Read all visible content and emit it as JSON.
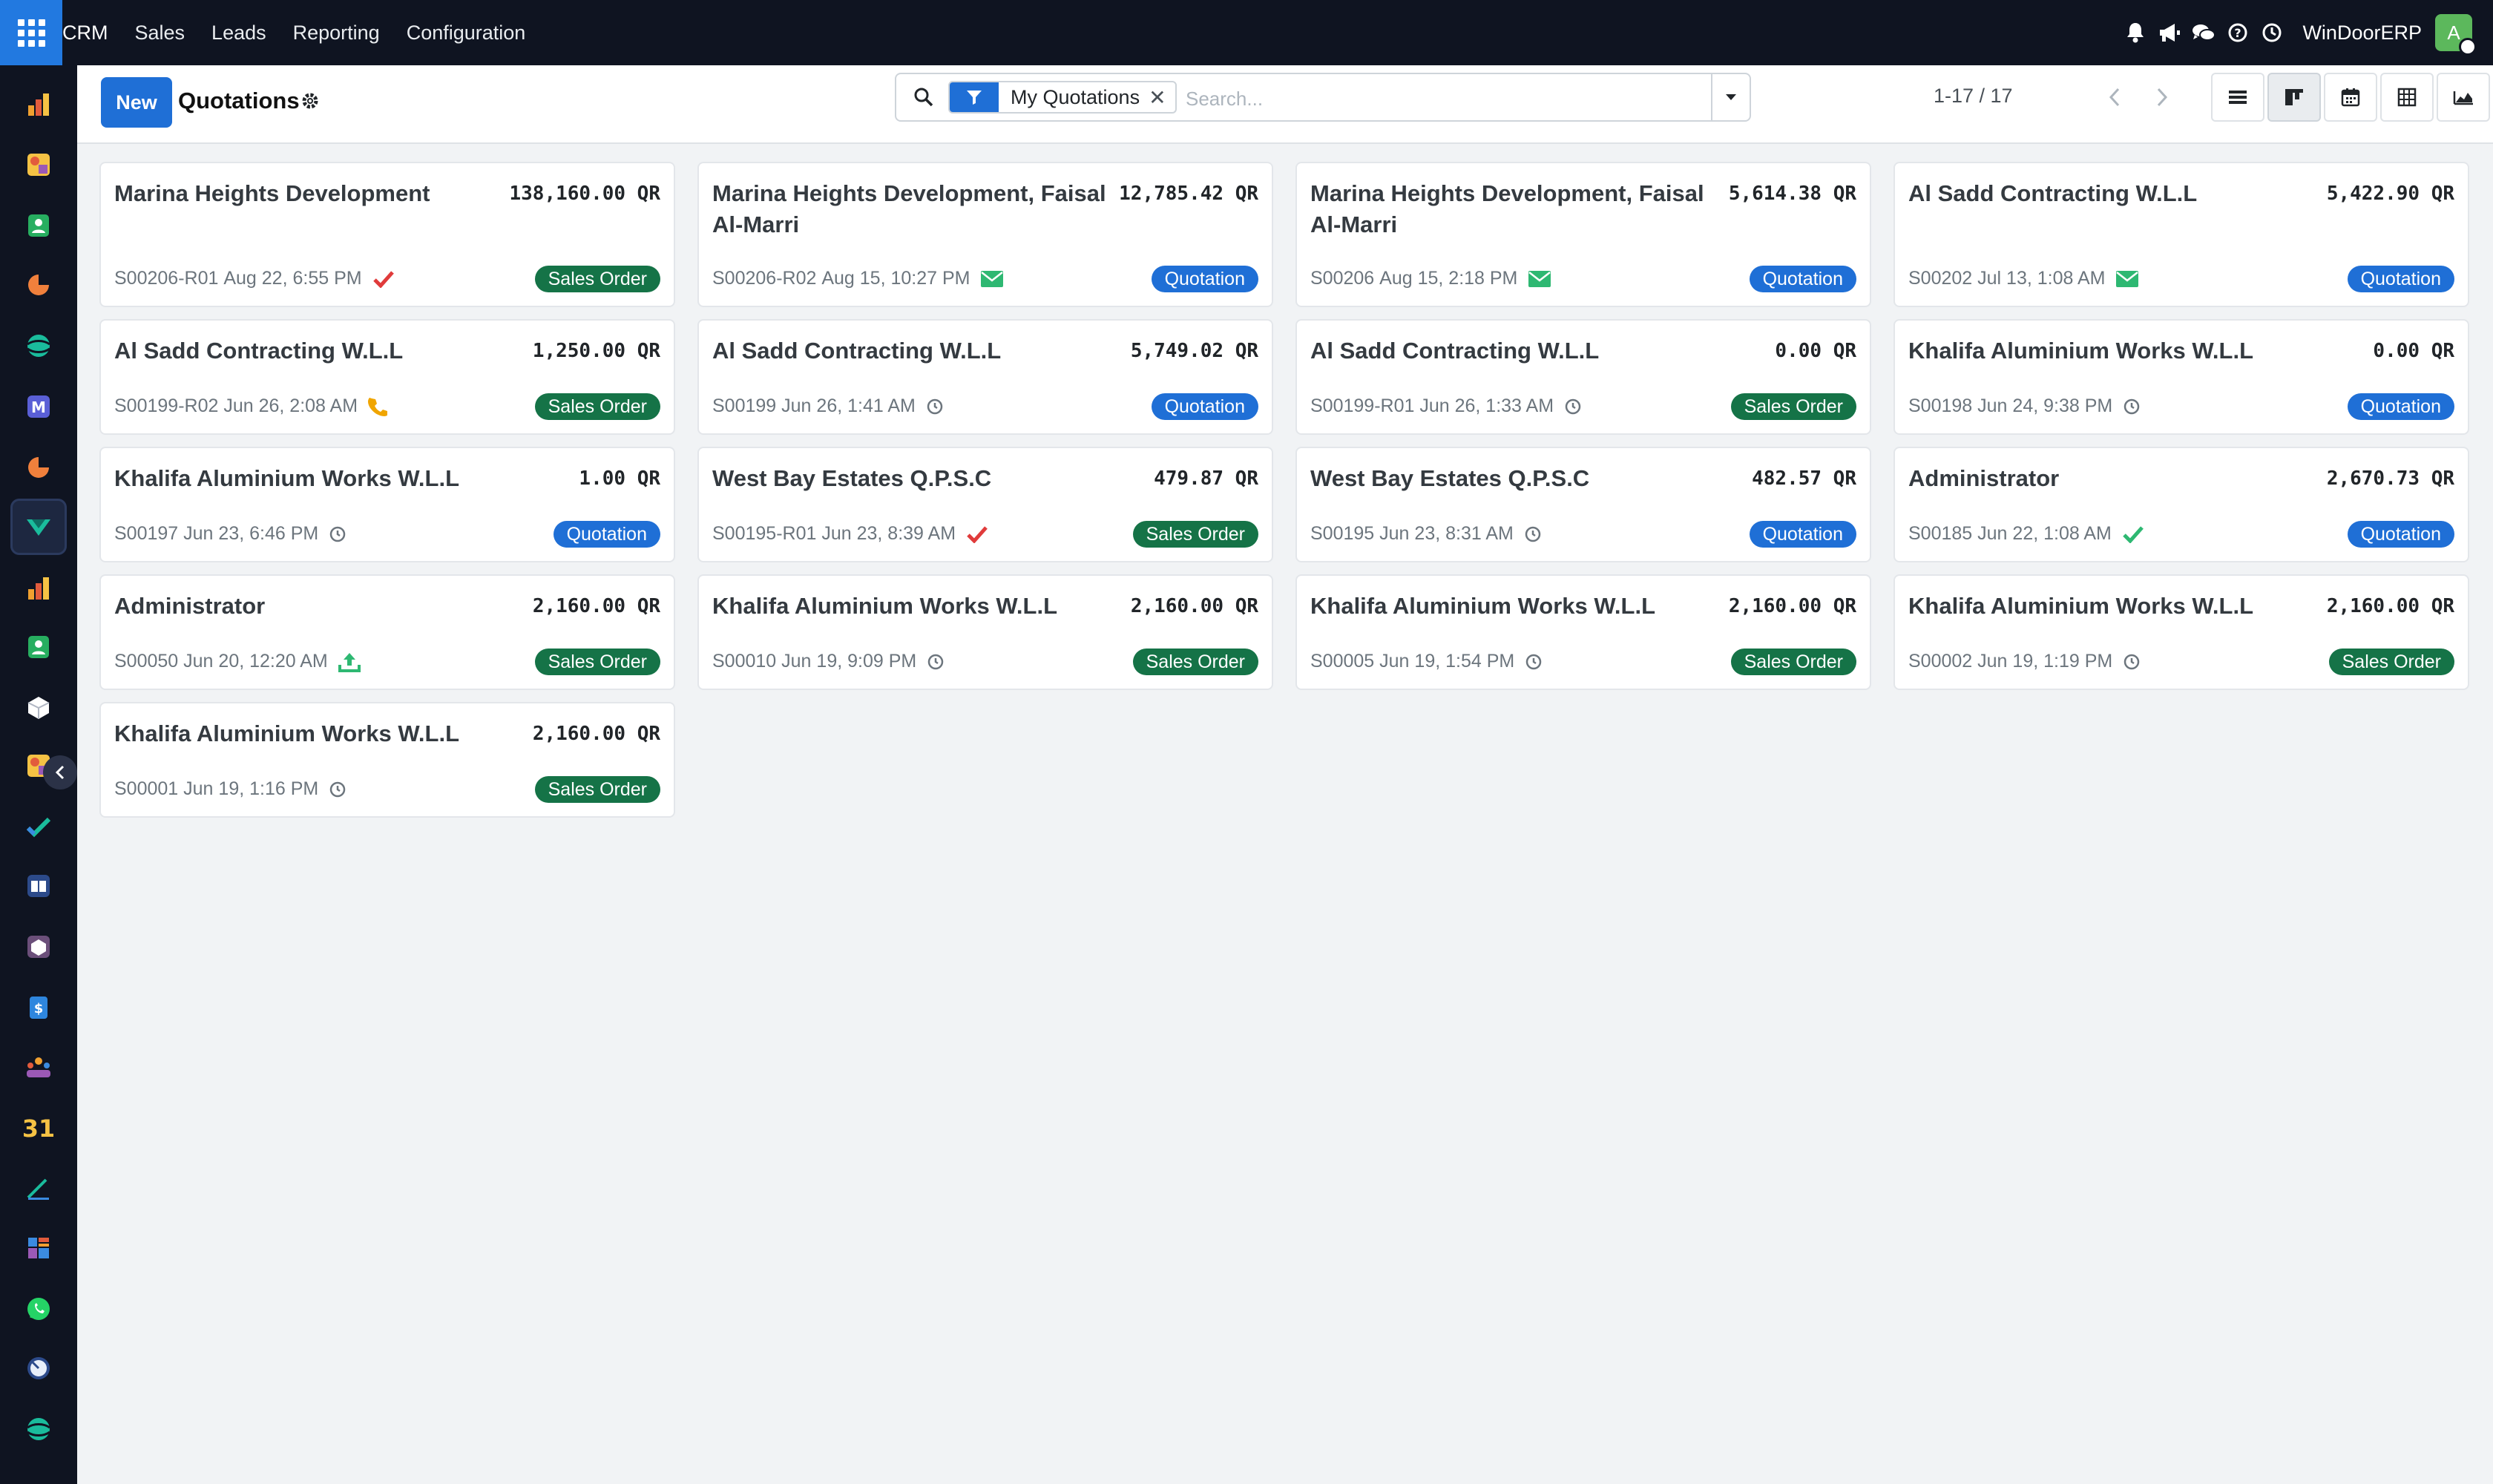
{
  "nav": {
    "menu": [
      "CRM",
      "Sales",
      "Leads",
      "Reporting",
      "Configuration"
    ],
    "company": "WinDoorERP",
    "avatar_letter": "A"
  },
  "control": {
    "new_label": "New",
    "title": "Quotations",
    "facet_label": "My Quotations",
    "search_placeholder": "Search...",
    "pager": "1-17 / 17"
  },
  "colors": {
    "sales_order": "#157347",
    "quotation": "#1f6fd6",
    "email_icon": "#2eb872",
    "check_red": "#e03b3b",
    "phone": "#f0a500"
  },
  "cards": [
    {
      "name": "Marina Heights Development",
      "amount": "138,160.00 QR",
      "ref": "S00206-R01",
      "date": "Aug 22, 6:55 PM",
      "activity": "check-red-icon",
      "status": "Sales Order"
    },
    {
      "name": "Marina Heights Development, Faisal Al-Marri",
      "amount": "12,785.42 QR",
      "ref": "S00206-R02",
      "date": "Aug 15, 10:27 PM",
      "activity": "email-icon",
      "status": "Quotation"
    },
    {
      "name": "Marina Heights Development, Faisal Al-Marri",
      "amount": "5,614.38 QR",
      "ref": "S00206",
      "date": "Aug 15, 2:18 PM",
      "activity": "email-icon",
      "status": "Quotation"
    },
    {
      "name": "Al Sadd Contracting W.L.L",
      "amount": "5,422.90 QR",
      "ref": "S00202",
      "date": "Jul 13, 1:08 AM",
      "activity": "email-icon",
      "status": "Quotation"
    },
    {
      "name": "Al Sadd Contracting W.L.L",
      "amount": "1,250.00 QR",
      "ref": "S00199-R02",
      "date": "Jun 26, 2:08 AM",
      "activity": "phone-icon",
      "status": "Sales Order"
    },
    {
      "name": "Al Sadd Contracting W.L.L",
      "amount": "5,749.02 QR",
      "ref": "S00199",
      "date": "Jun 26, 1:41 AM",
      "activity": "clock-icon",
      "status": "Quotation"
    },
    {
      "name": "Al Sadd Contracting W.L.L",
      "amount": "0.00 QR",
      "ref": "S00199-R01",
      "date": "Jun 26, 1:33 AM",
      "activity": "clock-icon",
      "status": "Sales Order"
    },
    {
      "name": "Khalifa Aluminium Works W.L.L",
      "amount": "0.00 QR",
      "ref": "S00198",
      "date": "Jun 24, 9:38 PM",
      "activity": "clock-icon",
      "status": "Quotation"
    },
    {
      "name": "Khalifa Aluminium Works W.L.L",
      "amount": "1.00 QR",
      "ref": "S00197",
      "date": "Jun 23, 6:46 PM",
      "activity": "clock-icon",
      "status": "Quotation"
    },
    {
      "name": "West Bay Estates Q.P.S.C",
      "amount": "479.87 QR",
      "ref": "S00195-R01",
      "date": "Jun 23, 8:39 AM",
      "activity": "check-red-icon",
      "status": "Sales Order"
    },
    {
      "name": "West Bay Estates Q.P.S.C",
      "amount": "482.57 QR",
      "ref": "S00195",
      "date": "Jun 23, 8:31 AM",
      "activity": "clock-icon",
      "status": "Quotation"
    },
    {
      "name": "Administrator",
      "amount": "2,670.73 QR",
      "ref": "S00185",
      "date": "Jun 22, 1:08 AM",
      "activity": "check-green-icon",
      "status": "Quotation"
    },
    {
      "name": "Administrator",
      "amount": "2,160.00 QR",
      "ref": "S00050",
      "date": "Jun 20, 12:20 AM",
      "activity": "upload-icon",
      "status": "Sales Order"
    },
    {
      "name": "Khalifa Aluminium Works W.L.L",
      "amount": "2,160.00 QR",
      "ref": "S00010",
      "date": "Jun 19, 9:09 PM",
      "activity": "clock-icon",
      "status": "Sales Order"
    },
    {
      "name": "Khalifa Aluminium Works W.L.L",
      "amount": "2,160.00 QR",
      "ref": "S00005",
      "date": "Jun 19, 1:54 PM",
      "activity": "clock-icon",
      "status": "Sales Order"
    },
    {
      "name": "Khalifa Aluminium Works W.L.L",
      "amount": "2,160.00 QR",
      "ref": "S00002",
      "date": "Jun 19, 1:19 PM",
      "activity": "clock-icon",
      "status": "Sales Order"
    },
    {
      "name": "Khalifa Aluminium Works W.L.L",
      "amount": "2,160.00 QR",
      "ref": "S00001",
      "date": "Jun 19, 1:16 PM",
      "activity": "clock-icon",
      "status": "Sales Order"
    }
  ]
}
